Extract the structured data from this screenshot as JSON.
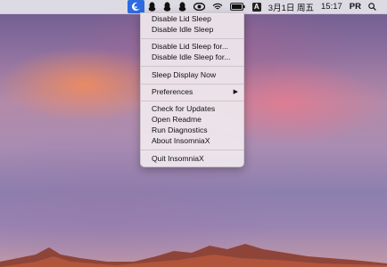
{
  "menubar": {
    "status_items": [
      {
        "name": "insomniax-icon"
      },
      {
        "name": "qq-penguin-icon"
      },
      {
        "name": "qq-penguin-icon-2"
      },
      {
        "name": "qq-penguin-icon-3"
      },
      {
        "name": "eye-icon"
      },
      {
        "name": "wifi-icon"
      },
      {
        "name": "battery-icon"
      },
      {
        "name": "input-source-icon"
      }
    ],
    "input_source_label": "A",
    "date": "3月1日 周五",
    "time": "15:17",
    "user": "PR"
  },
  "menu": {
    "items": [
      {
        "label": "Disable Lid Sleep"
      },
      {
        "label": "Disable Idle Sleep"
      },
      {
        "label": "Disable Lid Sleep for..."
      },
      {
        "label": "Disable Idle Sleep for..."
      },
      {
        "label": "Sleep Display Now"
      },
      {
        "label": "Preferences"
      },
      {
        "label": "Check for Updates"
      },
      {
        "label": "Open Readme"
      },
      {
        "label": "Run Diagnostics"
      },
      {
        "label": "About InsomniaX"
      },
      {
        "label": "Quit InsomniaX"
      }
    ]
  },
  "colors": {
    "menubar_bg": "#ececee",
    "active_item": "#2d6be0",
    "menu_bg": "#f0e8ee"
  }
}
